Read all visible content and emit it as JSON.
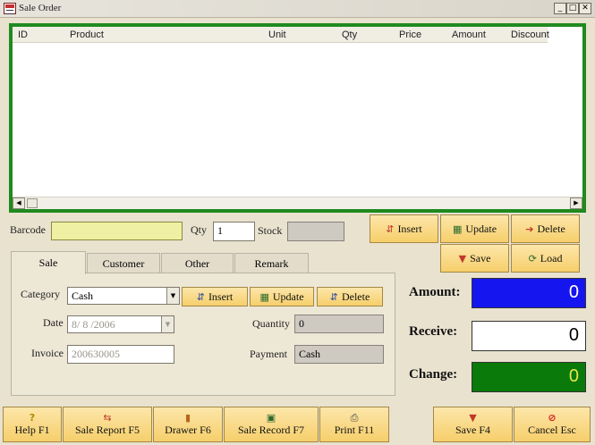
{
  "window": {
    "title": "Sale Order",
    "controls": {
      "minimize": "_",
      "maximize": "□",
      "close": "✕"
    }
  },
  "grid": {
    "columns": [
      "ID",
      "Product",
      "Unit",
      "Qty",
      "Price",
      "Amount",
      "Discount"
    ],
    "rows": []
  },
  "entry": {
    "barcode_label": "Barcode",
    "barcode_value": "",
    "qty_label": "Qty",
    "qty_value": "1",
    "stock_label": "Stock",
    "stock_value": ""
  },
  "item_actions": {
    "insert": "Insert",
    "update": "Update",
    "delete": "Delete",
    "save": "Save",
    "load": "Load"
  },
  "tabs": [
    "Sale",
    "Customer",
    "Other",
    "Remark"
  ],
  "sale_tab": {
    "category_label": "Category",
    "category_value": "Cash",
    "insert": "Insert",
    "update": "Update",
    "delete": "Delete",
    "date_label": "Date",
    "date_value": " 8/ 8 /2006",
    "invoice_label": "Invoice",
    "invoice_value": "200630005",
    "quantity_label": "Quantity",
    "quantity_value": "0",
    "payment_label": "Payment",
    "payment_value": "Cash"
  },
  "totals": {
    "amount_label": "Amount:",
    "amount_value": "0",
    "receive_label": "Receive:",
    "receive_value": "0",
    "change_label": "Change:",
    "change_value": "0"
  },
  "colors": {
    "grid_border": "#1f8a1f",
    "amount_bg": "#1515f0",
    "change_bg": "#0a7a0a",
    "barcode_bg": "#f0f0a4",
    "button_face": "#f6cf6b"
  },
  "footer": {
    "help": "Help F1",
    "sale_report": "Sale Report F5",
    "drawer": "Drawer F6",
    "sale_record": "Sale Record F7",
    "print": "Print F11",
    "save": "Save F4",
    "cancel": "Cancel Esc"
  },
  "icons": {
    "help": "?",
    "sale_report": "⇆",
    "drawer": "▮",
    "sale_record": "▣",
    "print": "⎙",
    "save": "▼",
    "cancel": "⊘",
    "insert": "⇵",
    "update": "▦",
    "delete": "➔",
    "save_small": "▼",
    "load": "⟳"
  }
}
